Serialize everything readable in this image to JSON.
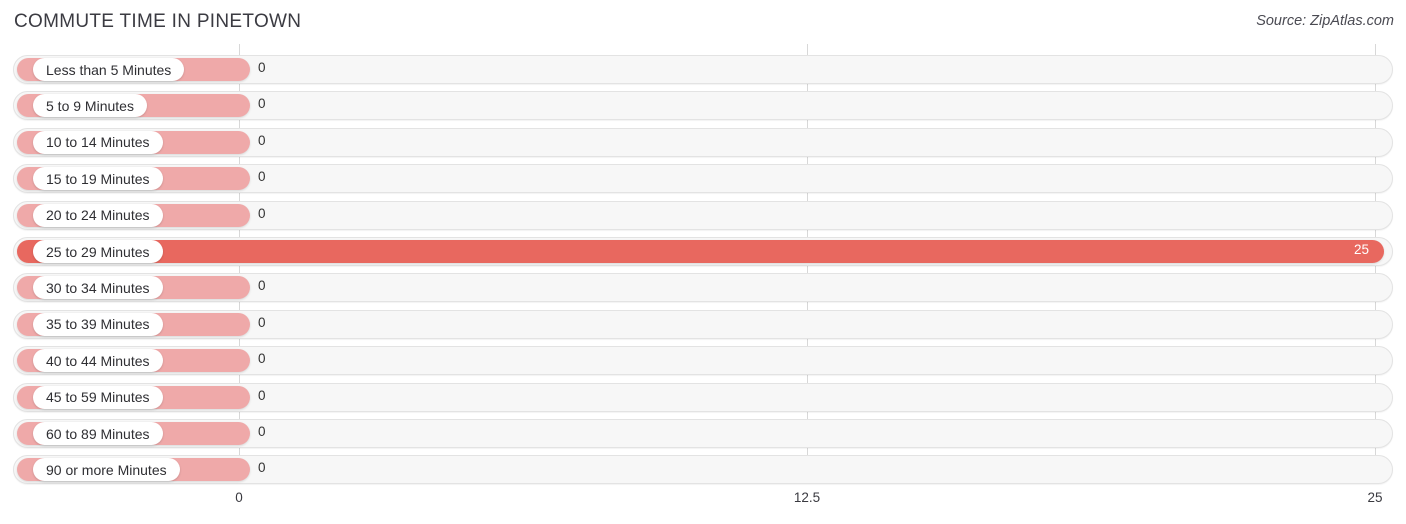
{
  "header": {
    "title": "COMMUTE TIME IN PINETOWN",
    "source": "Source: ZipAtlas.com"
  },
  "colors": {
    "bar_zero": "#efa9a9",
    "bar_full": "#e8685f",
    "track_fill": "#f7f7f7",
    "track_border": "#e3e3e3",
    "gridline": "#d8d8d8",
    "text": "#333333",
    "value_inside": "#ffffff"
  },
  "chart_data": {
    "type": "bar",
    "orientation": "horizontal",
    "title": "COMMUTE TIME IN PINETOWN",
    "xlabel": "",
    "ylabel": "",
    "xlim": [
      0,
      25
    ],
    "xticks": [
      0,
      12.5,
      25
    ],
    "xtick_labels": [
      "0",
      "12.5",
      "25"
    ],
    "grid": true,
    "legend": false,
    "categories": [
      "Less than 5 Minutes",
      "5 to 9 Minutes",
      "10 to 14 Minutes",
      "15 to 19 Minutes",
      "20 to 24 Minutes",
      "25 to 29 Minutes",
      "30 to 34 Minutes",
      "35 to 39 Minutes",
      "40 to 44 Minutes",
      "45 to 59 Minutes",
      "60 to 89 Minutes",
      "90 or more Minutes"
    ],
    "values": [
      0,
      0,
      0,
      0,
      0,
      25,
      0,
      0,
      0,
      0,
      0,
      0
    ],
    "value_labels": [
      "0",
      "0",
      "0",
      "0",
      "0",
      "25",
      "0",
      "0",
      "0",
      "0",
      "0",
      "0"
    ]
  }
}
